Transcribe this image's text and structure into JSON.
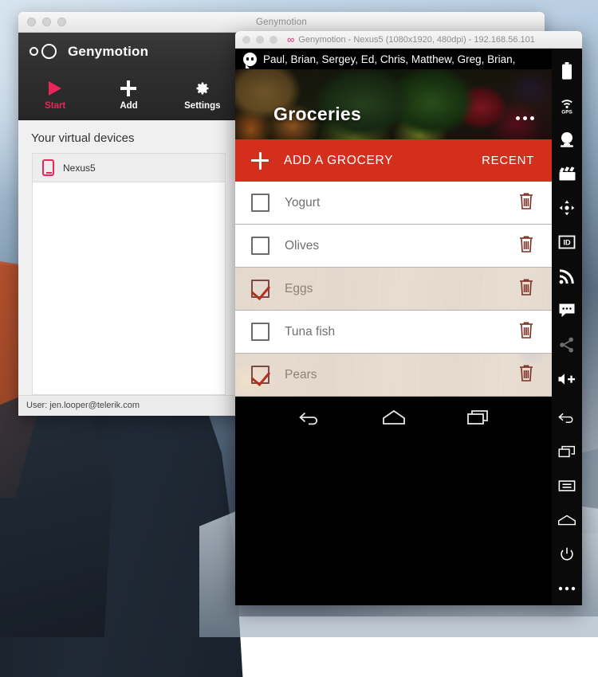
{
  "desktop": {
    "wallpaper_name": "osx-yosemite-el-capitan"
  },
  "genymotion_window": {
    "title": "Genymotion",
    "logo_name": "genymotion-logo",
    "brand": "Genymotion",
    "toolbar": [
      {
        "label": "Start",
        "icon": "play-icon"
      },
      {
        "label": "Add",
        "icon": "plus-icon"
      },
      {
        "label": "Settings",
        "icon": "gear-icon"
      }
    ],
    "devices_heading": "Your virtual devices",
    "devices": [
      {
        "name": "Nexus5",
        "icon": "phone-icon"
      }
    ],
    "footer": "User: jen.looper@telerik.com"
  },
  "emulator_window": {
    "title": "Genymotion - Nexus5 (1080x1920, 480dpi) - 192.168.56.101",
    "infinity_icon": "infinity-icon",
    "status_bar": {
      "icon": "hangouts-icon",
      "text": "Paul, Brian, Sergey, Ed, Chris, Matthew, Greg, Brian,"
    },
    "app": {
      "title": "Groceries",
      "overflow_icon": "overflow-dots-icon",
      "add_label": "ADD A GROCERY",
      "add_icon": "plus-icon",
      "recent_label": "RECENT",
      "accent_color": "#d32f1c",
      "items": [
        {
          "label": "Yogurt",
          "checked": false,
          "delete_icon": "trash-icon"
        },
        {
          "label": "Olives",
          "checked": false,
          "delete_icon": "trash-icon"
        },
        {
          "label": "Eggs",
          "checked": true,
          "delete_icon": "trash-icon"
        },
        {
          "label": "Tuna fish",
          "checked": false,
          "delete_icon": "trash-icon"
        },
        {
          "label": "Pears",
          "checked": true,
          "delete_icon": "trash-icon"
        }
      ]
    },
    "nav_bar": [
      {
        "icon": "back-icon"
      },
      {
        "icon": "home-icon"
      },
      {
        "icon": "recents-icon"
      }
    ],
    "sidebar": [
      {
        "icon": "battery-icon",
        "label": "Battery"
      },
      {
        "icon": "gps-icon",
        "label": "GPS"
      },
      {
        "icon": "camera-icon",
        "label": "Camera"
      },
      {
        "icon": "video-icon",
        "label": "Screen recording"
      },
      {
        "icon": "dpad-icon",
        "label": "Rotation"
      },
      {
        "icon": "identifiers-icon",
        "label": "ID"
      },
      {
        "icon": "network-icon",
        "label": "Network"
      },
      {
        "icon": "sms-icon",
        "label": "SMS"
      },
      {
        "icon": "share-icon",
        "label": "Share",
        "dim": true
      },
      {
        "icon": "volume-up-icon",
        "label": "Volume"
      },
      {
        "icon": "back-icon",
        "label": "Back"
      },
      {
        "icon": "recents-icon",
        "label": "Recents"
      },
      {
        "icon": "menu-icon",
        "label": "Menu"
      },
      {
        "icon": "home-icon",
        "label": "Home"
      },
      {
        "icon": "power-icon",
        "label": "Power"
      },
      {
        "icon": "more-icon",
        "label": "More"
      }
    ]
  }
}
